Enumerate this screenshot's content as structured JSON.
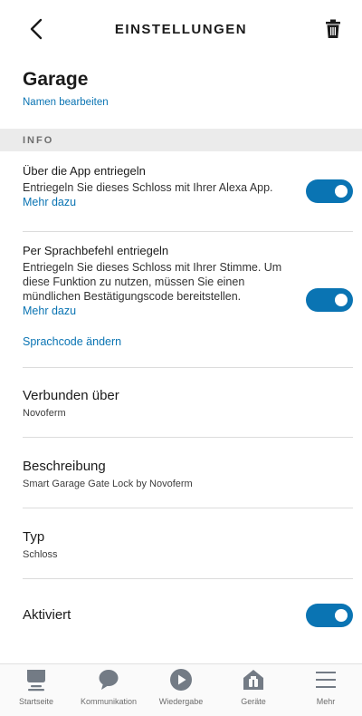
{
  "header": {
    "title": "EINSTELLUNGEN"
  },
  "device": {
    "name": "Garage",
    "rename_link": "Namen bearbeiten"
  },
  "section": {
    "label": "INFO"
  },
  "app_unlock": {
    "title": "Über die App entriegeln",
    "description": "Entriegeln Sie dieses Schloss mit Ihrer Alexa App.",
    "more": "Mehr dazu",
    "enabled": true
  },
  "voice_unlock": {
    "title": "Per Sprachbefehl entriegeln",
    "description": "Entriegeln Sie dieses Schloss mit Ihrer Stimme. Um diese Funktion zu nutzen, müssen Sie einen mündlichen Bestätigungscode bereitstellen.",
    "more": "Mehr dazu",
    "change_code": "Sprachcode ändern",
    "enabled": true
  },
  "connected": {
    "title": "Verbunden über",
    "value": "Novoferm"
  },
  "description_info": {
    "title": "Beschreibung",
    "value": "Smart Garage Gate Lock by Novoferm"
  },
  "type_info": {
    "title": "Typ",
    "value": "Schloss"
  },
  "activated": {
    "title": "Aktiviert",
    "enabled": true
  },
  "tabs": [
    {
      "label": "Startseite",
      "icon": "home-icon"
    },
    {
      "label": "Kommunikation",
      "icon": "chat-bubble-icon"
    },
    {
      "label": "Wiedergabe",
      "icon": "play-icon"
    },
    {
      "label": "Geräte",
      "icon": "devices-house-icon"
    },
    {
      "label": "Mehr",
      "icon": "menu-icon"
    }
  ],
  "colors": {
    "accent": "#0a74b3",
    "icon_gray": "#737b85",
    "band": "#ebebeb"
  }
}
